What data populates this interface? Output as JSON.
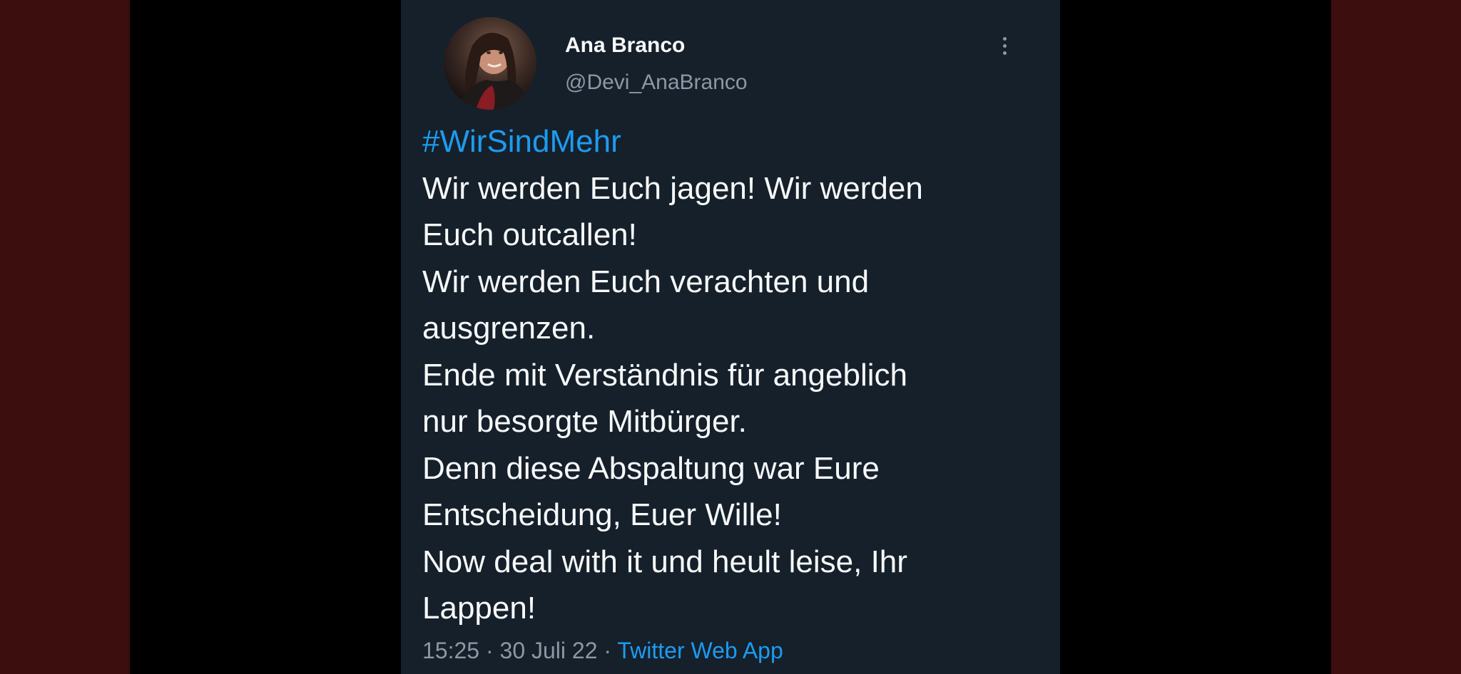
{
  "tweet": {
    "author": {
      "display_name": "Ana Branco",
      "handle": "@Devi_AnaBranco"
    },
    "hashtag": "#WirSindMehr",
    "lines": [
      "Wir werden Euch jagen! Wir werden",
      "Euch outcallen!",
      "Wir werden Euch verachten und",
      "ausgrenzen.",
      "Ende mit Verständnis für angeblich",
      "nur besorgte Mitbürger.",
      "Denn diese Abspaltung war Eure",
      "Entscheidung, Euer Wille!",
      "Now deal with it und heult leise, Ihr",
      "Lappen!"
    ],
    "time": "15:25",
    "separator": "·",
    "date": "30 Juli 22",
    "source": "Twitter Web App"
  },
  "icons": {
    "more": "more-vertical-icon"
  },
  "colors": {
    "background": "#15202b",
    "link": "#1d9bf0",
    "secondary_text": "#8b98a5",
    "side_bars": "#3d0e0e"
  }
}
